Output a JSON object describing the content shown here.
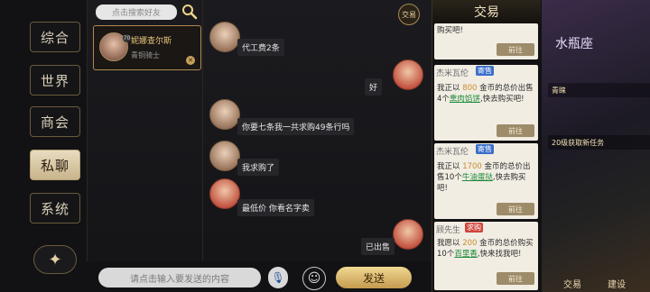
{
  "sidebar": {
    "tabs": [
      {
        "label": "综合"
      },
      {
        "label": "世界"
      },
      {
        "label": "商会"
      },
      {
        "label": "私聊",
        "active": true
      },
      {
        "label": "系统"
      }
    ],
    "back_icon": "sparkle-icon"
  },
  "friends": {
    "search_placeholder": "点击搜索好友",
    "items": [
      {
        "name": "妮娜查尔斯",
        "title": "青铜骑士",
        "level": "70"
      }
    ]
  },
  "header": {
    "trade_toggle": "交易"
  },
  "chat": {
    "messages": [
      {
        "side": "left",
        "text": "代工费2条"
      },
      {
        "side": "right",
        "text": "好"
      },
      {
        "side": "left",
        "text": "你要七条我一共求购49条行吗"
      },
      {
        "side": "left",
        "text": "我求购了"
      },
      {
        "side": "left",
        "text": "最低价 你看名字卖"
      },
      {
        "side": "right",
        "text": "已出售"
      }
    ]
  },
  "input": {
    "placeholder": "请点击输入要发送的内容",
    "send_label": "发送"
  },
  "trade": {
    "title": "交易",
    "cards": [
      {
        "seller": "",
        "tag": "",
        "text_top": "购买吧!",
        "button": "前往"
      },
      {
        "seller": "杰米瓦伦",
        "tag": "寄售",
        "tag_color": "#3a6ec9",
        "pre": "我正以 ",
        "amount": "800",
        "mid": " 金币的总价出售4个",
        "item": "熏肉馅饼",
        "post": ",快去购买吧!",
        "button": "前往"
      },
      {
        "seller": "杰米瓦伦",
        "tag": "寄售",
        "tag_color": "#3a6ec9",
        "pre": "我正以 ",
        "amount": "1700",
        "mid": " 金币的总价出售10个",
        "item": "牛油蛋挞",
        "post": ",快去购买吧!",
        "button": "前往"
      },
      {
        "seller": "顾先生",
        "tag": "求购",
        "tag_color": "#d0453a",
        "pre": "我愿以 ",
        "amount": "200",
        "mid": " 金币的总价购买10个",
        "item": "百里香",
        "post": ",快来找我吧!",
        "button": "前往"
      }
    ]
  },
  "background": {
    "banner": "水瓶座",
    "rows": [
      "青睐",
      "20级获取新任务"
    ],
    "nav": [
      "交易",
      "建设"
    ]
  }
}
